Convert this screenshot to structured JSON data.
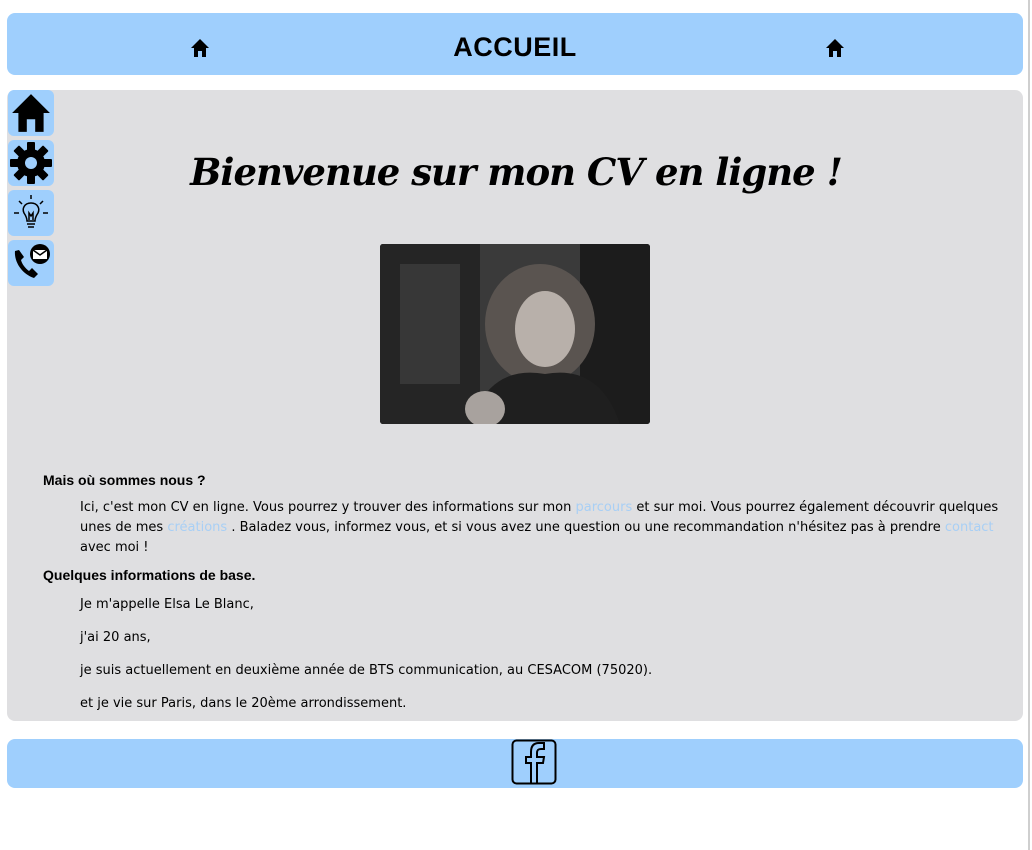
{
  "header": {
    "title": "ACCUEIL",
    "left_icon": "home-icon",
    "right_icon": "home-icon"
  },
  "sidebar": {
    "items": [
      {
        "icon": "home-icon"
      },
      {
        "icon": "gear-icon"
      },
      {
        "icon": "lightbulb-icon"
      },
      {
        "icon": "phone-mail-icon"
      }
    ]
  },
  "main": {
    "hero_title": "Bienvenue sur mon CV en ligne !",
    "photo_alt_icon": "portrait-photo",
    "section1_heading": "Mais où sommes nous ?",
    "section1_text_a": "Ici, c'est mon CV en ligne. Vous pourrez y trouver des informations sur mon ",
    "link_parcours": "parcours",
    "section1_text_b": " et sur moi. Vous pourrez également découvrir quelques unes de mes ",
    "link_creations": "créations",
    "section1_text_c": " . Baladez vous, informez vous, et si vous avez une question ou une recommandation n'hésitez pas à prendre ",
    "link_contact": "contact",
    "section1_text_d": " avec moi !",
    "section2_heading": "Quelques informations de base.",
    "info_lines": [
      "Je m'appelle Elsa Le Blanc,",
      "j'ai 20 ans,",
      "je suis actuellement en deuxième année de BTS communication, au CESACOM (75020).",
      "et je vie sur Paris, dans le 20ème arrondissement."
    ]
  },
  "footer": {
    "icon": "facebook-icon"
  },
  "colors": {
    "accent": "#9fcffd",
    "panel": "#dfdfe1",
    "link": "#a8cff5"
  }
}
